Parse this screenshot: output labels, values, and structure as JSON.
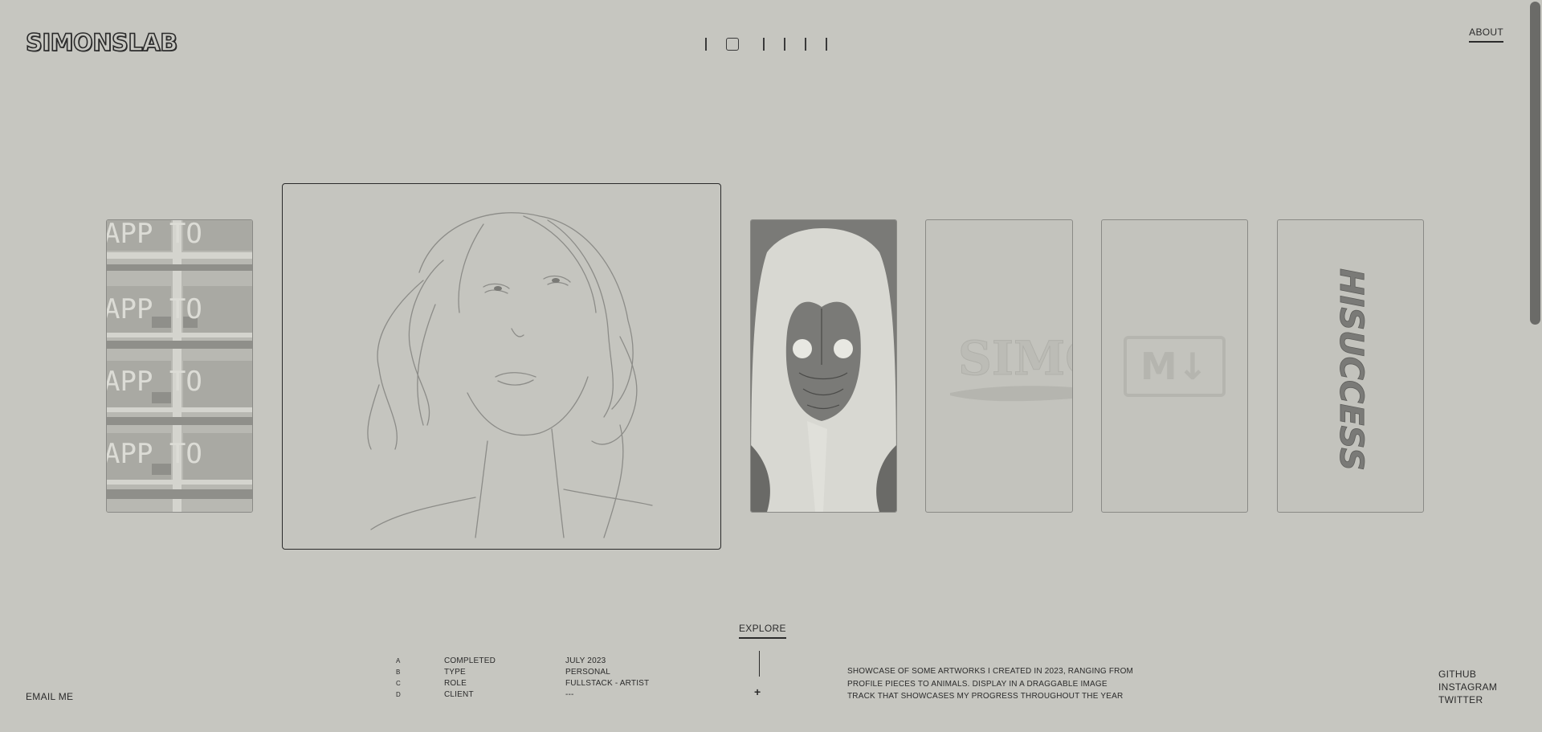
{
  "header": {
    "logo": "SIMONSLAB",
    "about_label": "ABOUT"
  },
  "gallery": {
    "cards": [
      {
        "name": "app-tokens-artwork",
        "text": "APP TO"
      },
      {
        "name": "woman-sketch-artwork",
        "text": ""
      },
      {
        "name": "hooded-figure-artwork",
        "text": ""
      },
      {
        "name": "simonslab-logo-artwork",
        "text": "SIMO"
      },
      {
        "name": "markdown-logo-artwork",
        "text": "M↓"
      },
      {
        "name": "hisuccess-artwork",
        "text": "HISUCCESS"
      }
    ]
  },
  "footer": {
    "email_label": "EMAIL ME",
    "explore_label": "EXPLORE",
    "plus": "+",
    "info": [
      {
        "letter": "A",
        "label": "COMPLETED",
        "value": "JULY 2023"
      },
      {
        "letter": "B",
        "label": "TYPE",
        "value": "PERSONAL"
      },
      {
        "letter": "C",
        "label": "ROLE",
        "value": "FULLSTACK - ARTIST"
      },
      {
        "letter": "D",
        "label": "CLIENT",
        "value": "---"
      }
    ],
    "description": "SHOWCASE OF SOME ARTWORKS I CREATED IN 2023, RANGING FROM PROFILE PIECES TO ANIMALS. DISPLAY IN A DRAGGABLE IMAGE TRACK THAT SHOWCASES MY PROGRESS THROUGHOUT THE YEAR",
    "social": [
      "GITHUB",
      "INSTAGRAM",
      "TWITTER"
    ]
  }
}
